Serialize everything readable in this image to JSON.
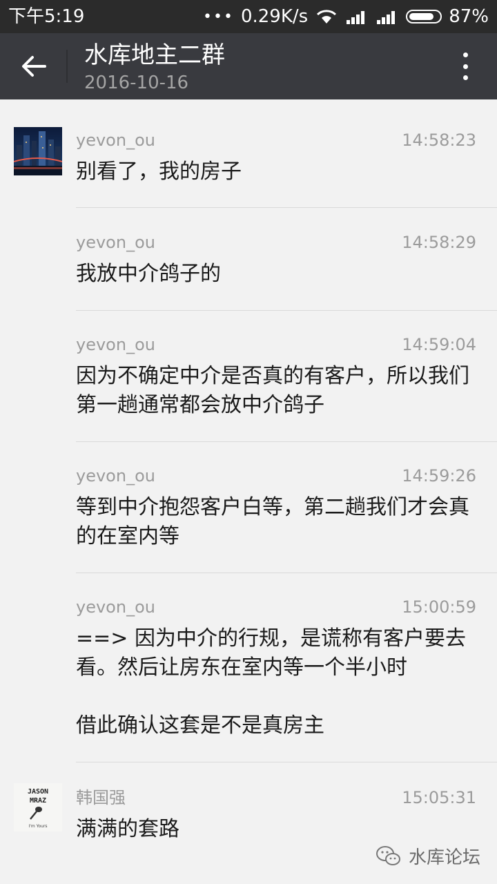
{
  "status_bar": {
    "time": "下午5:19",
    "dots": "•••",
    "net_speed": "0.29K/s",
    "battery_percent": "87%",
    "battery_level": 0.87
  },
  "header": {
    "title": "水库地主二群",
    "date": "2016-10-16"
  },
  "messages": [
    {
      "name": "yevon_ou",
      "time": "14:58:23",
      "text": "别看了，我的房子"
    },
    {
      "name": "yevon_ou",
      "time": "14:58:29",
      "text": "我放中介鸽子的"
    },
    {
      "name": "yevon_ou",
      "time": "14:59:04",
      "text": "因为不确定中介是否真的有客户，所以我们第一趟通常都会放中介鸽子"
    },
    {
      "name": "yevon_ou",
      "time": "14:59:26",
      "text": "等到中介抱怨客户白等，第二趟我们才会真的在室内等"
    },
    {
      "name": "yevon_ou",
      "time": "15:00:59",
      "text": "==> 因为中介的行规，是谎称有客户要去看。然后让房东在室内等一个半小时\n\n借此确认这套是不是真房主"
    },
    {
      "name": "韩国强",
      "time": "15:05:31",
      "text": "满满的套路"
    }
  ],
  "avatar2": {
    "line1": "JASON",
    "line2": "MRAZ",
    "line3": "I'm Yours"
  },
  "watermark": {
    "text": "水库论坛",
    "icon": "wechat-icon"
  }
}
